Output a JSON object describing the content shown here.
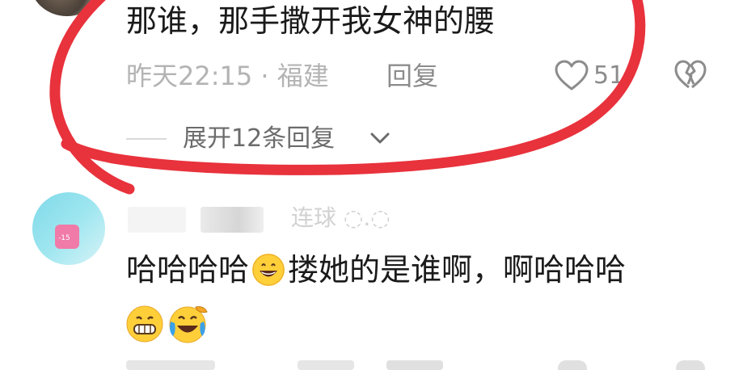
{
  "comment1": {
    "text": "那谁，那手撒开我女神的腰",
    "meta": "昨天22:15 · 福建",
    "reply_label": "回复",
    "like_count": "51",
    "expand_label": "展开12条回复"
  },
  "comment2": {
    "username_fragment": "连球 ◌.◌",
    "text_part1": "哈哈哈哈",
    "text_part2": "搂她的是谁啊，啊哈哈哈",
    "avatar_text": "-15"
  },
  "colors": {
    "annotation": "#e8323c",
    "meta": "#b3b3b3",
    "text": "#1a1a1a"
  },
  "icons": {
    "like": "heart-outline-icon",
    "dislike": "broken-heart-icon",
    "expand": "chevron-down-icon"
  }
}
